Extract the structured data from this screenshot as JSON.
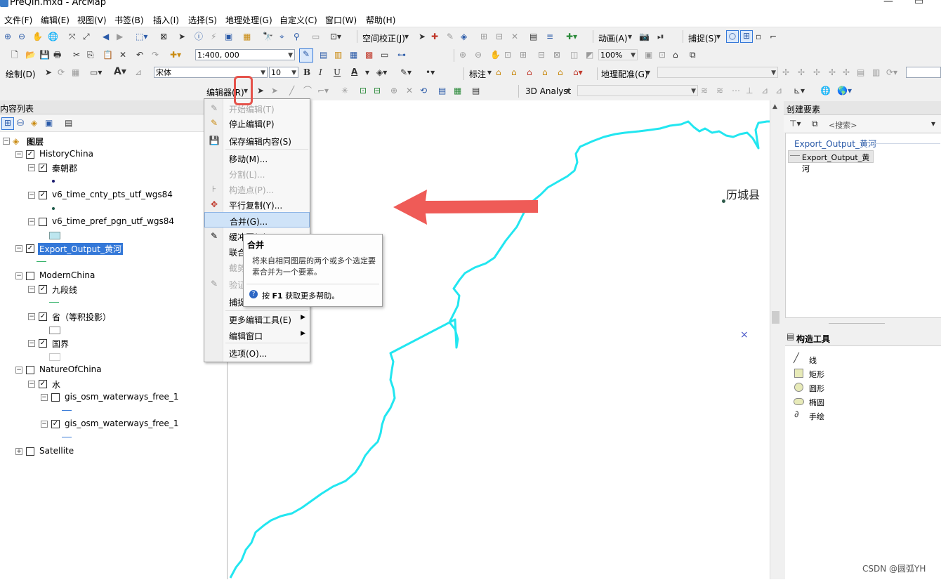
{
  "window": {
    "title": "PreQin.mxd - ArcMap"
  },
  "menubar": [
    "文件(F)",
    "编辑(E)",
    "视图(V)",
    "书签(B)",
    "插入(I)",
    "选择(S)",
    "地理处理(G)",
    "自定义(C)",
    "窗口(W)",
    "帮助(H)"
  ],
  "toolbar1": {
    "spatial_adjust": "空间校正(J)",
    "animation": "动画(A)",
    "snapping": "捕捉(S)"
  },
  "toolbar2": {
    "scale": "1:400, 000",
    "zoom": "100%"
  },
  "toolbar3": {
    "draw": "绘制(D)",
    "font": "宋体",
    "font_size": "10",
    "bold": "B",
    "italic": "I",
    "underline": "U",
    "font_color": "A",
    "label": "标注",
    "georef": "地理配准(G)"
  },
  "toolbar4": {
    "editor": "编辑器(R)",
    "analyst": "3D Analyst"
  },
  "toc": {
    "title": "内容列表",
    "root": "图层",
    "groups": [
      {
        "name": "HistoryChina",
        "checked": true
      },
      {
        "name": "秦朝郡",
        "checked": true
      },
      {
        "name": "v6_time_cnty_pts_utf_wgs84",
        "checked": true
      },
      {
        "name": "v6_time_pref_pgn_utf_wgs84",
        "checked": false
      },
      {
        "name": "Export_Output_黄河",
        "checked": true
      },
      {
        "name": "ModernChina",
        "checked": false
      },
      {
        "name": "九段线",
        "checked": true
      },
      {
        "name": "省（等积投影）",
        "checked": true
      },
      {
        "name": "国界",
        "checked": true
      },
      {
        "name": "NatureOfChina",
        "checked": false
      },
      {
        "name": "水",
        "checked": true
      },
      {
        "name": "gis_osm_waterways_free_1",
        "checked": false
      },
      {
        "name": "gis_osm_waterways_free_1",
        "checked": true
      },
      {
        "name": "Satellite",
        "checked": false
      }
    ]
  },
  "menu": {
    "items": [
      {
        "label": "开始编辑(T)",
        "enabled": false
      },
      {
        "label": "停止编辑(P)",
        "enabled": true
      },
      {
        "label": "保存编辑内容(S)",
        "enabled": true
      },
      {
        "label": "移动(M)...",
        "enabled": true
      },
      {
        "label": "分割(L)...",
        "enabled": false
      },
      {
        "label": "构造点(P)...",
        "enabled": false
      },
      {
        "label": "平行复制(Y)...",
        "enabled": true
      },
      {
        "label": "合并(G)...",
        "enabled": true
      },
      {
        "label": "缓冲区(B)...",
        "enabled": true
      },
      {
        "label": "联合",
        "enabled": true
      },
      {
        "label": "截剪",
        "enabled": false
      },
      {
        "label": "验证",
        "enabled": false
      },
      {
        "label": "捕捉",
        "enabled": true
      },
      {
        "label": "更多编辑工具(E)",
        "enabled": true
      },
      {
        "label": "编辑窗口",
        "enabled": true
      },
      {
        "label": "选项(O)...",
        "enabled": true
      }
    ]
  },
  "tooltip": {
    "title": "合并",
    "desc": "将来自相同图层的两个或多个选定要素合并为一个要素。",
    "help_prefix": "按 ",
    "help_key": "F1",
    "help_suffix": " 获取更多帮助。"
  },
  "map": {
    "label": "历城县",
    "line_color": "#22e6f0"
  },
  "create_features": {
    "title": "创建要素",
    "search_placeholder": "<搜索>",
    "layer_header": "Export_Output_黄河",
    "layer_item": "Export_Output_黄河"
  },
  "construct_tools": {
    "title": "构造工具",
    "items": [
      "线",
      "矩形",
      "圆形",
      "椭圆",
      "手绘"
    ]
  },
  "watermark": "CSDN @圆弧YH"
}
